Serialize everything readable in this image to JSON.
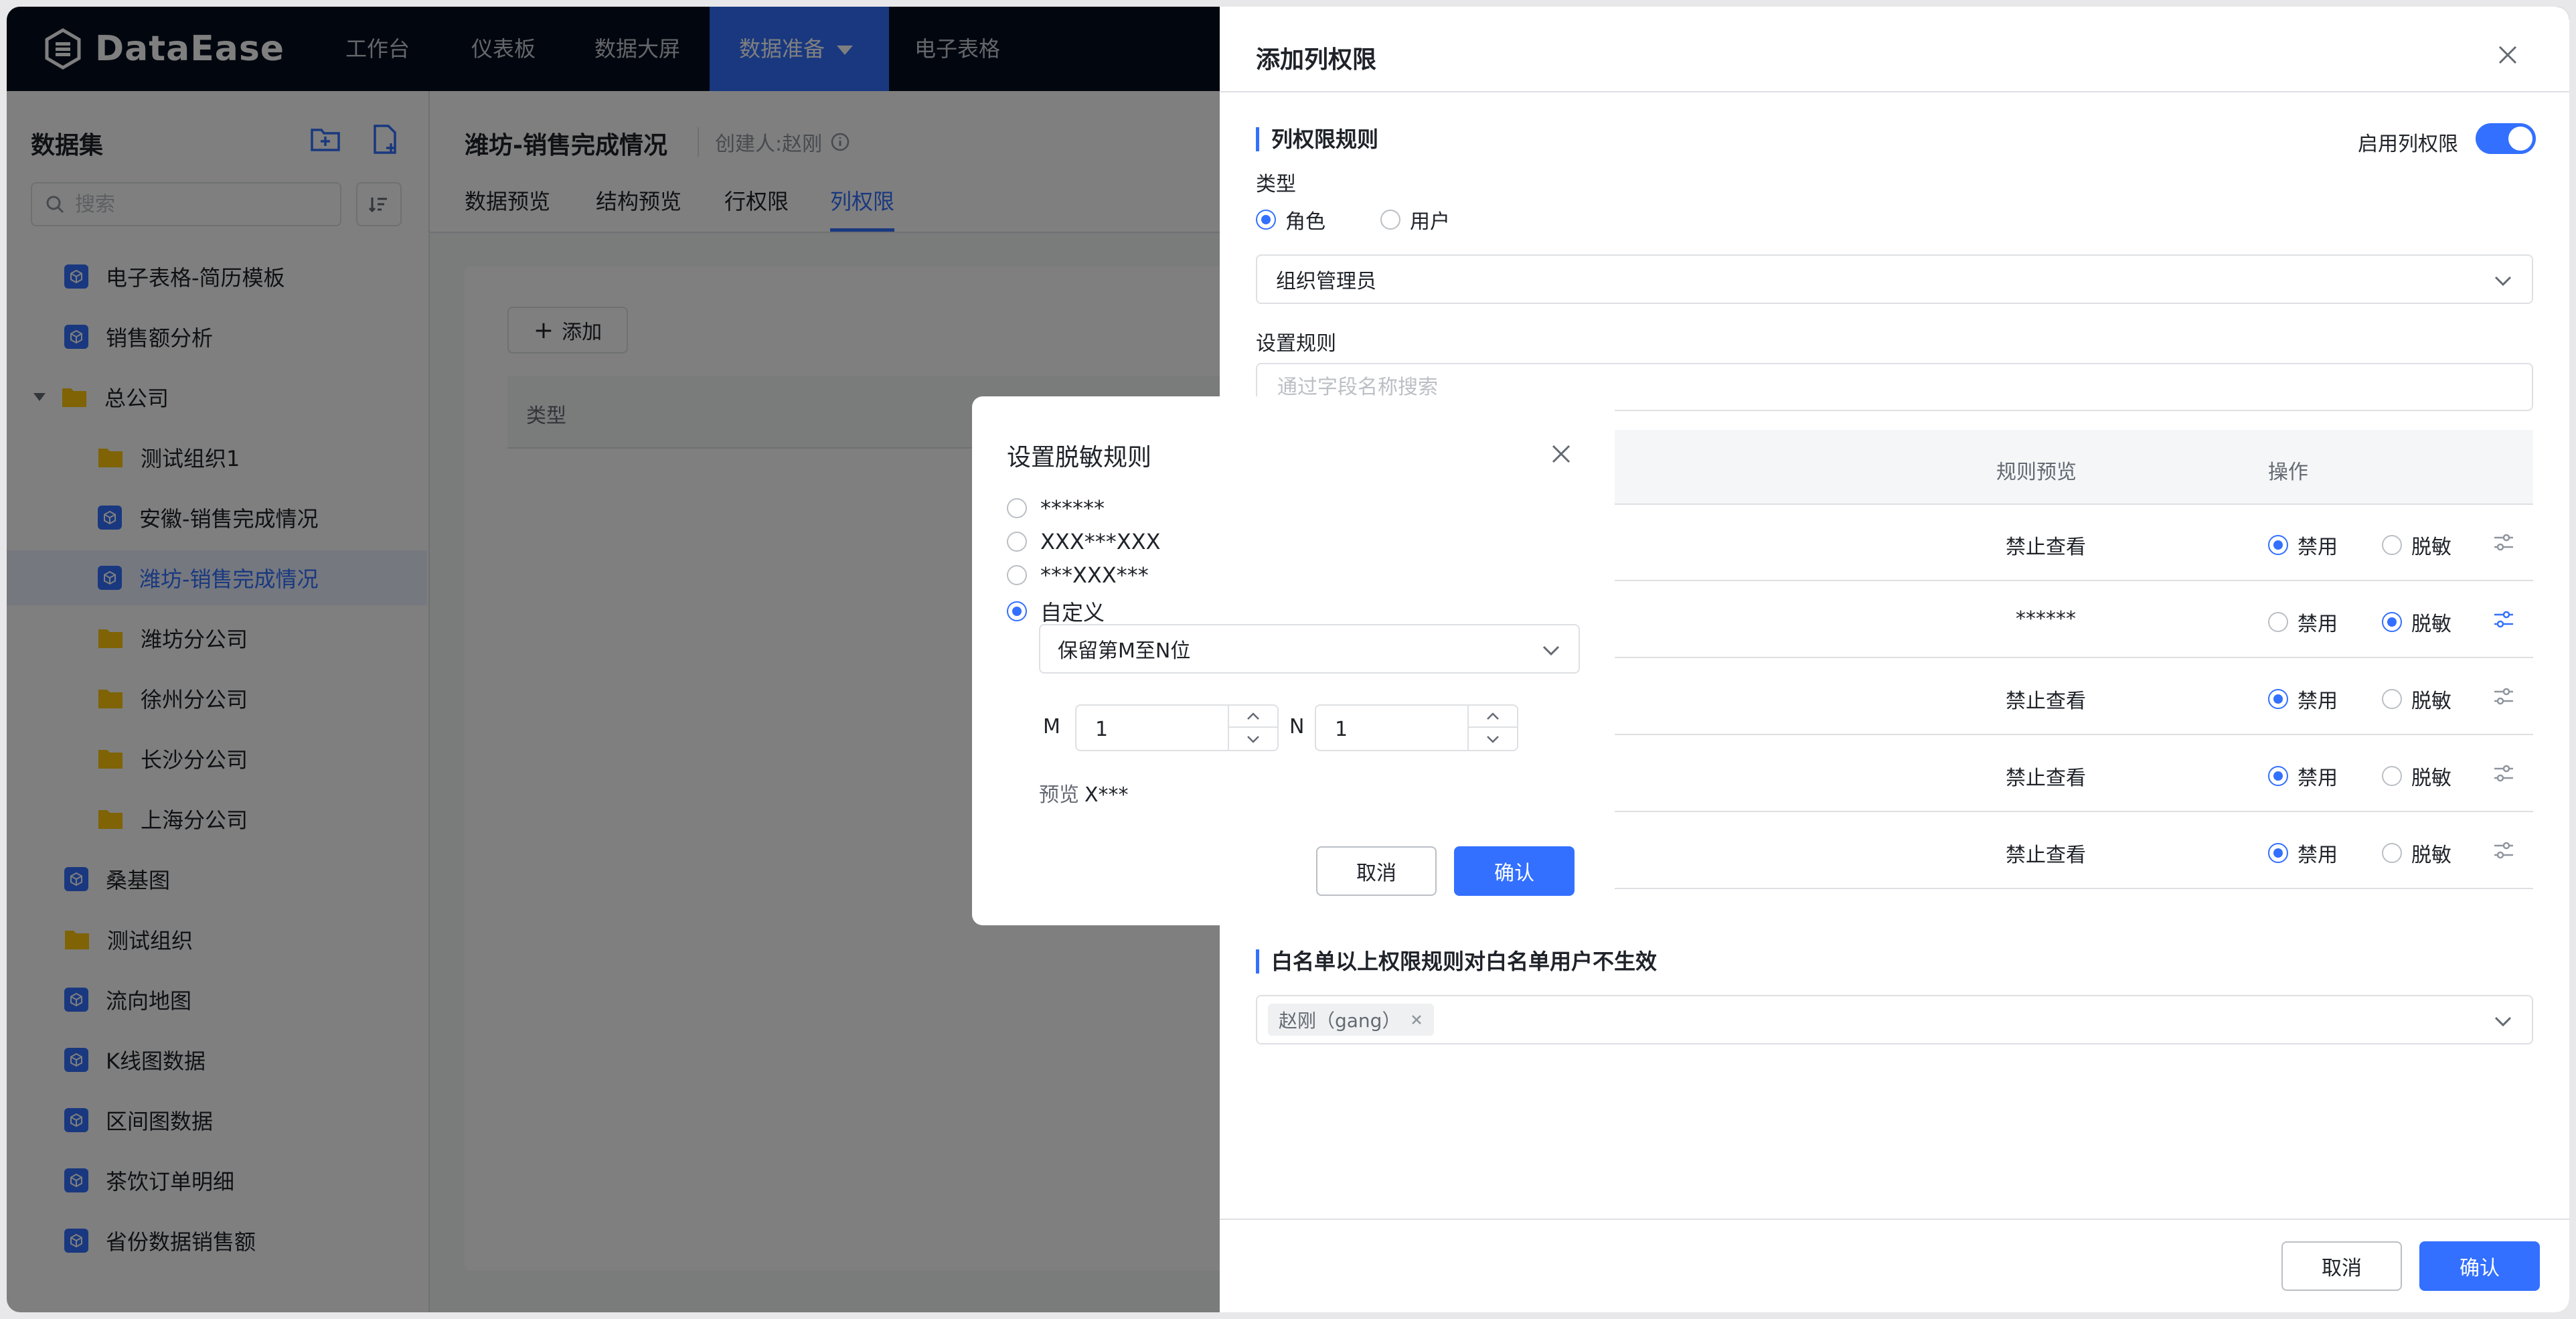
{
  "app": {
    "logo_text": "DataEase",
    "nav": [
      "工作台",
      "仪表板",
      "数据大屏",
      "数据准备",
      "电子表格"
    ],
    "active_nav": "数据准备"
  },
  "sidebar": {
    "title": "数据集",
    "search_placeholder": "搜索",
    "items": [
      {
        "label": "电子表格-简历模板",
        "type": "dataset"
      },
      {
        "label": "销售额分析",
        "type": "dataset"
      },
      {
        "label": "总公司",
        "type": "folder-expanded"
      },
      {
        "label": "测试组织1",
        "type": "folder"
      },
      {
        "label": "安徽-销售完成情况",
        "type": "dataset"
      },
      {
        "label": "潍坊-销售完成情况",
        "type": "dataset",
        "selected": true
      },
      {
        "label": "潍坊分公司",
        "type": "folder"
      },
      {
        "label": "徐州分公司",
        "type": "folder"
      },
      {
        "label": "长沙分公司",
        "type": "folder"
      },
      {
        "label": "上海分公司",
        "type": "folder"
      },
      {
        "label": "桑基图",
        "type": "dataset"
      },
      {
        "label": "测试组织",
        "type": "folder"
      },
      {
        "label": "流向地图",
        "type": "dataset"
      },
      {
        "label": "K线图数据",
        "type": "dataset"
      },
      {
        "label": "区间图数据",
        "type": "dataset"
      },
      {
        "label": "茶饮订单明细",
        "type": "dataset"
      },
      {
        "label": "省份数据销售额",
        "type": "dataset"
      }
    ]
  },
  "main": {
    "title": "潍坊-销售完成情况",
    "creator": "创建人:赵刚",
    "tabs": [
      "数据预览",
      "结构预览",
      "行权限",
      "列权限"
    ],
    "active_tab": "列权限",
    "add_label": "添加",
    "table_header": "类型"
  },
  "drawer": {
    "title": "添加列权限",
    "section_rule": "列权限规则",
    "enable_label": "启用列权限",
    "enabled": true,
    "type_label": "类型",
    "type_options": [
      "角色",
      "用户"
    ],
    "type_selected": "角色",
    "role_value": "组织管理员",
    "set_rule_label": "设置规则",
    "field_search_placeholder": "通过字段名称搜索",
    "columns": {
      "preview": "规则预览",
      "action": "操作"
    },
    "rows": [
      {
        "preview": "禁止查看",
        "mode": "禁用"
      },
      {
        "preview": "******",
        "mode": "脱敏"
      },
      {
        "preview": "禁止查看",
        "mode": "禁用"
      },
      {
        "preview": "禁止查看",
        "mode": "禁用"
      },
      {
        "preview": "禁止查看",
        "mode": "禁用"
      }
    ],
    "opt_disable": "禁用",
    "opt_mask": "脱敏",
    "section_whitelist": "白名单以上权限规则对白名单用户不生效",
    "whitelist_tag": "赵刚（gang）",
    "cancel": "取消",
    "confirm": "确认"
  },
  "dialog": {
    "title": "设置脱敏规则",
    "options": [
      "******",
      "XXX***XXX",
      "***XXX***",
      "自定义"
    ],
    "selected": "自定义",
    "custom_select": "保留第M至N位",
    "m_label": "M",
    "m_value": "1",
    "n_label": "N",
    "n_value": "1",
    "preview_label": "预览",
    "preview_value": "X***",
    "cancel": "取消",
    "confirm": "确认"
  },
  "colors": {
    "primary": "#3370ff",
    "nav_bg": "#050e1f",
    "mask": "rgba(0,0,0,0.5)"
  }
}
